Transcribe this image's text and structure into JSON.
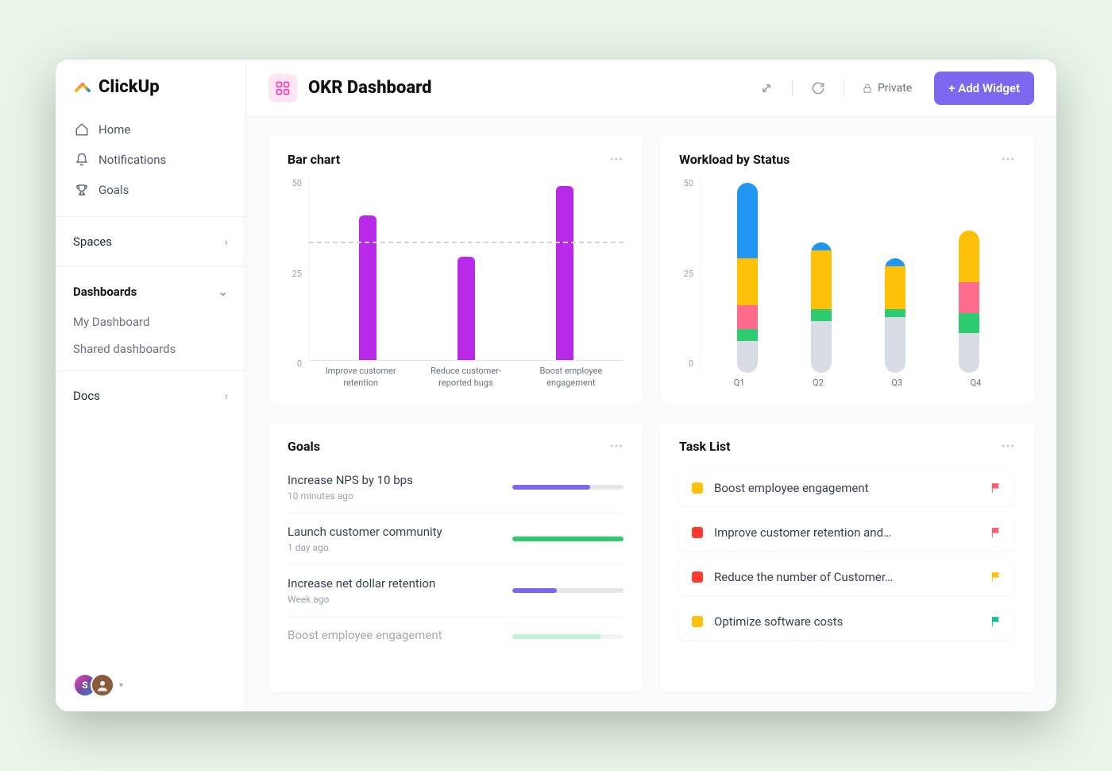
{
  "brand": "ClickUp",
  "nav": {
    "home": "Home",
    "notifications": "Notifications",
    "goals": "Goals"
  },
  "sections": {
    "spaces": "Spaces",
    "dashboards": "Dashboards",
    "dash_items": [
      "My Dashboard",
      "Shared dashboards"
    ],
    "docs": "Docs"
  },
  "avatar_initial": "S",
  "header": {
    "title": "OKR Dashboard",
    "private": "Private",
    "add_widget": "+ Add Widget"
  },
  "cards": {
    "bar_title": "Bar chart",
    "workload_title": "Workload by Status",
    "goals_title": "Goals",
    "tasks_title": "Task List"
  },
  "chart_data": [
    {
      "type": "bar",
      "title": "Bar chart",
      "ylabel": "",
      "xlabel": "",
      "ylim": [
        0,
        50
      ],
      "yticks": [
        0,
        25,
        50
      ],
      "guideline_at": 32,
      "categories": [
        "Improve customer retention",
        "Reduce customer-reported bugs",
        "Boost employee engagement"
      ],
      "values": [
        39,
        28,
        47
      ],
      "color": "#b829e8"
    },
    {
      "type": "bar",
      "stacked": true,
      "title": "Workload by Status",
      "ylim": [
        0,
        50
      ],
      "yticks": [
        0,
        25,
        50
      ],
      "categories": [
        "Q1",
        "Q2",
        "Q3",
        "Q4"
      ],
      "series": [
        {
          "name": "grey",
          "color": "#d8dde5",
          "values": [
            8,
            13,
            14,
            10
          ]
        },
        {
          "name": "green",
          "color": "#2ecc71",
          "values": [
            3,
            3,
            2,
            5
          ]
        },
        {
          "name": "pink",
          "color": "#ff6b8b",
          "values": [
            6,
            0,
            0,
            8
          ]
        },
        {
          "name": "yellow",
          "color": "#ffc107",
          "values": [
            12,
            15,
            11,
            13
          ]
        },
        {
          "name": "blue",
          "color": "#2196f3",
          "values": [
            19,
            2,
            2,
            0
          ]
        }
      ]
    }
  ],
  "goals": [
    {
      "title": "Increase NPS by 10 bps",
      "time": "10 minutes ago",
      "progress": 70,
      "color": "#7b68ee"
    },
    {
      "title": "Launch customer community",
      "time": "1 day ago",
      "progress": 100,
      "color": "#2ecc71"
    },
    {
      "title": "Increase net dollar retention",
      "time": "Week ago",
      "progress": 40,
      "color": "#7b68ee"
    },
    {
      "title": "Boost employee engagement",
      "time": "",
      "progress": 80,
      "color": "#7be6a8",
      "faded": true
    }
  ],
  "tasks": [
    {
      "status_color": "#ffc107",
      "title": "Boost employee engagement",
      "flag_color": "#ff5c6c"
    },
    {
      "status_color": "#ff3b30",
      "title": "Improve customer retention and…",
      "flag_color": "#ff5c6c"
    },
    {
      "status_color": "#ff3b30",
      "title": "Reduce the number of Customer…",
      "flag_color": "#ffc107"
    },
    {
      "status_color": "#ffc107",
      "title": "Optimize software costs",
      "flag_color": "#1abc9c"
    }
  ]
}
